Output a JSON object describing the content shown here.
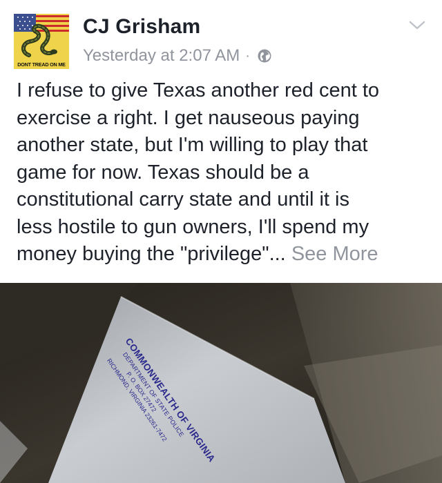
{
  "post": {
    "author": "CJ Grisham",
    "avatar_caption": "DONT TREAD ON ME",
    "timestamp": "Yesterday at 2:07 AM",
    "separator": "·",
    "privacy_icon": "globe-icon",
    "menu_icon": "chevron-down-icon",
    "body_lines": [
      "I refuse to give Texas another red cent to",
      "exercise a right. I get nauseous paying",
      "another state, but I'm willing to play that",
      "game for now.  Texas should be a",
      "constitutional carry state and until it is",
      "less hostile to gun owners, I'll spend my",
      "money buying the \"privilege\"..."
    ],
    "see_more": "See More"
  },
  "photo": {
    "envelope_lines": [
      "COMMONWEALTH OF VIRGINIA",
      "DEPARTMENT OF STATE POLICE",
      "P. O. BOX 27472",
      "RICHMOND, VIRGINIA 23261-7472"
    ]
  },
  "colors": {
    "author_text": "#1d2129",
    "meta_text": "#90949c",
    "avatar_bg": "#efd34a",
    "envelope_ink": "#2b2a8c"
  }
}
